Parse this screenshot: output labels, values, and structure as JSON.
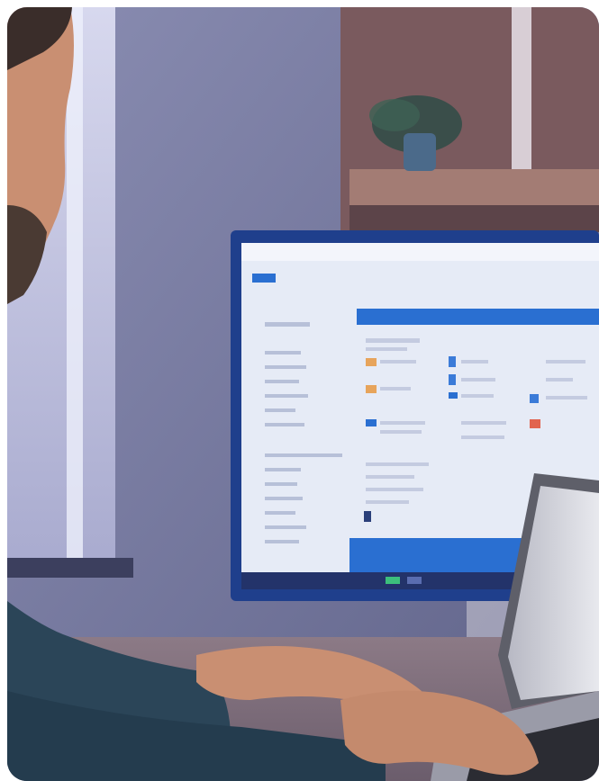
{
  "scene": {
    "subject": "person-typing-on-laptop",
    "colors": {
      "wall": "#7a7fa6",
      "monitor_bezel": "#1f3f8c",
      "screen_bg": "#e6ebf6",
      "taskbar": "#2a6fd1",
      "shirt": "#2b4558",
      "skin": "#c98f72",
      "shelf": "#8a6a62",
      "window_light": "#c9cbe6"
    },
    "icons": [
      "folder-icon",
      "document-icon",
      "mail-icon",
      "calendar-icon"
    ]
  }
}
